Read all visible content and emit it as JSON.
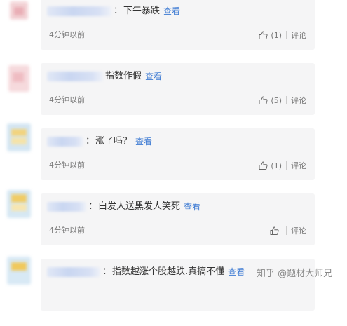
{
  "comments": [
    {
      "content": "下午暴跌",
      "view_label": "查看",
      "time": "4分钟以前",
      "like_count": "",
      "reply_label": "评论"
    },
    {
      "content": "指数作假",
      "view_label": "查看",
      "time": "4分钟以前",
      "like_count": "",
      "reply_label": "评论"
    },
    {
      "content": "涨了吗？",
      "view_label": "查看",
      "time": "4分钟以前",
      "like_count": "",
      "reply_label": "评论"
    },
    {
      "content": "白发人送黑发人笑死",
      "view_label": "查看",
      "time": "4分钟以前",
      "like_count": "",
      "reply_label": "评论"
    },
    {
      "content": "指数越涨个股越跌.真搞不懂",
      "view_label": "查看"
    }
  ],
  "likes": [
    "(1)",
    "(5)",
    "(1)",
    ""
  ],
  "watermark": "知乎 @题材大师兄",
  "icons": {
    "like": "thumbs-up-icon"
  },
  "colors": {
    "card_bg": "#f5f5f6",
    "link": "#3e7bd3",
    "meta_text": "#777777"
  }
}
